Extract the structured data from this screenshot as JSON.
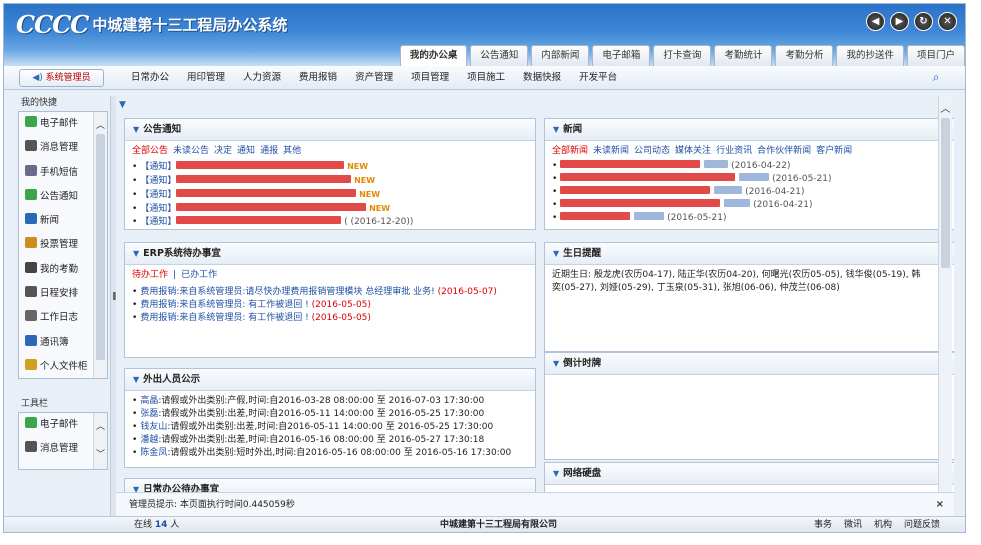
{
  "header": {
    "logo_mark": "CCCC",
    "app_title": "中城建第十三工程局办公系统",
    "controls": [
      "back-icon",
      "forward-icon",
      "refresh-icon",
      "close-icon"
    ],
    "tabs": [
      {
        "label": "我的办公桌",
        "active": true
      },
      {
        "label": "公告通知",
        "active": false
      },
      {
        "label": "内部新闻",
        "active": false
      },
      {
        "label": "电子邮箱",
        "active": false
      },
      {
        "label": "打卡查询",
        "active": false
      },
      {
        "label": "考勤统计",
        "active": false
      },
      {
        "label": "考勤分析",
        "active": false
      },
      {
        "label": "我的抄送件",
        "active": false
      },
      {
        "label": "项目门户",
        "active": false
      }
    ]
  },
  "navbar": {
    "admin_label": "系统管理员",
    "menu": [
      "日常办公",
      "用印管理",
      "人力资源",
      "费用报销",
      "资产管理",
      "项目管理",
      "项目施工",
      "数据快报",
      "开发平台"
    ],
    "search_icon": "search-icon"
  },
  "sidebar": {
    "shortcuts_title": "我的快捷",
    "shortcuts": [
      {
        "label": "电子邮件",
        "icon": "mail-icon",
        "color": "#3aa64a"
      },
      {
        "label": "消息管理",
        "icon": "message-icon",
        "color": "#555555"
      },
      {
        "label": "手机短信",
        "icon": "phone-icon",
        "color": "#6a6a8a"
      },
      {
        "label": "公告通知",
        "icon": "notice-icon",
        "color": "#3aa64a"
      },
      {
        "label": "新闻",
        "icon": "news-icon",
        "color": "#2a68b8"
      },
      {
        "label": "投票管理",
        "icon": "vote-icon",
        "color": "#d08a20"
      },
      {
        "label": "我的考勤",
        "icon": "attendance-icon",
        "color": "#444444"
      },
      {
        "label": "日程安排",
        "icon": "calendar-icon",
        "color": "#555555"
      },
      {
        "label": "工作日志",
        "icon": "log-icon",
        "color": "#666666"
      },
      {
        "label": "通讯簿",
        "icon": "contacts-icon",
        "color": "#2a68b8"
      },
      {
        "label": "个人文件柜",
        "icon": "folder-icon",
        "color": "#d0a020"
      }
    ],
    "toolbar_title": "工具栏",
    "tools": [
      {
        "label": "电子邮件",
        "icon": "mail-icon",
        "color": "#3aa64a"
      },
      {
        "label": "消息管理",
        "icon": "message-icon",
        "color": "#555555"
      }
    ]
  },
  "panels": {
    "notice": {
      "title": "公告通知",
      "tabs": [
        "全部公告",
        "未读公告",
        "决定",
        "通知",
        "通报",
        "其他"
      ],
      "items": [
        {
          "prefix": "【通知】",
          "new": true
        },
        {
          "prefix": "【通知】",
          "new": true
        },
        {
          "prefix": "【通知】",
          "new": true
        },
        {
          "prefix": "【通知】",
          "new": true
        },
        {
          "prefix": "【通知】",
          "date": "2016-12-20",
          "new": false
        }
      ]
    },
    "erp": {
      "title": "ERP系统待办事宜",
      "tabs": [
        "待办工作",
        "已办工作"
      ],
      "items": [
        {
          "type": "费用报销",
          "text": ":来自系统管理员:请尽快办理费用报销管理模块 总经理审批 业务!",
          "date": "(2016-05-07)"
        },
        {
          "type": "费用报销",
          "text": ":来自系统管理员: 有工作被退回 !",
          "date": "(2016-05-05)"
        },
        {
          "type": "费用报销",
          "text": ":来自系统管理员: 有工作被退回 !",
          "date": "(2016-05-05)"
        }
      ]
    },
    "outside": {
      "title": "外出人员公示",
      "items": [
        {
          "name": "高晶",
          "text": ":请假或外出类别:产假,时间:自2016-03-28 08:00:00 至 2016-07-03 17:30:00"
        },
        {
          "name": "张磊",
          "text": ":请假或外出类别:出差,时间:自2016-05-11 14:00:00 至 2016-05-25 17:30:00"
        },
        {
          "name": "钱友山",
          "text": ":请假或外出类别:出差,时间:自2016-05-11 14:00:00 至 2016-05-25 17:30:00"
        },
        {
          "name": "潘越",
          "text": ":请假或外出类别:出差,时间:自2016-05-16 08:00:00 至 2016-05-27 17:30:18"
        },
        {
          "name": "陈金凤",
          "text": ":请假或外出类别:短时外出,时间:自2016-05-16 08:00:00 至 2016-05-16 17:30:00"
        }
      ]
    },
    "daily": {
      "title": "日常办公待办事宜"
    },
    "news": {
      "title": "新闻",
      "tabs": [
        "全部新闻",
        "未读新闻",
        "公司动态",
        "媒体关注",
        "行业资讯",
        "合作伙伴新闻",
        "客户新闻"
      ],
      "items": [
        {
          "date": "(2016-04-22)"
        },
        {
          "date": "(2016-05-21)"
        },
        {
          "date": "(2016-04-21)"
        },
        {
          "date": "(2016-04-21)"
        },
        {
          "date": "(2016-05-21)"
        }
      ]
    },
    "birthday": {
      "title": "生日提醒",
      "line1": "近期生日: 殷龙虎(农历04-17), 陆正华(农历04-20), 何曙光(农历05-05), 钱华俊(05-19), 韩",
      "line2": "奕(05-27), 刘娅(05-29), 丁玉泉(05-31), 张旭(06-06), 仲茂兰(06-08)"
    },
    "countdown": {
      "title": "倒计时牌"
    },
    "netdisk": {
      "title": "网络硬盘"
    }
  },
  "hint": {
    "text": "管理员提示: 本页面执行时间0.445059秒",
    "close": "×"
  },
  "footer": {
    "online_prefix": "在线",
    "online_count": "14",
    "online_suffix": "人",
    "company": "中城建第十三工程局有限公司",
    "links": [
      "事务",
      "微讯",
      "机构",
      "问题反馈"
    ]
  },
  "colors": {
    "header_blue": "#2b73c7",
    "link_blue": "#1f4fa3",
    "alert_red": "#dd0000"
  }
}
